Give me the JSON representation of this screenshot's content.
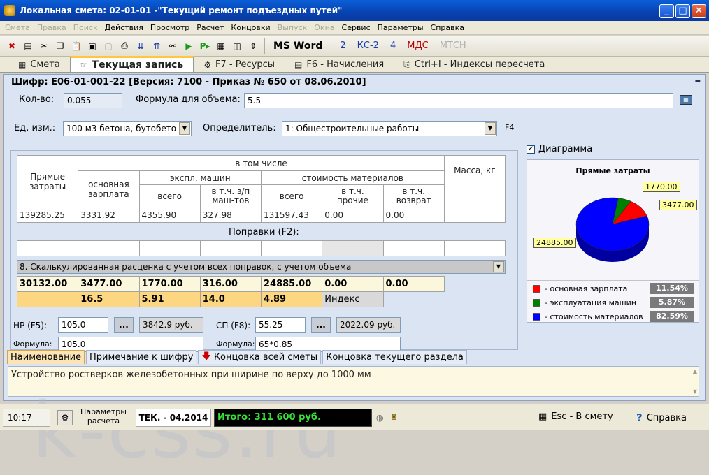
{
  "window": {
    "title": "Локальная смета: 02-01-01 -\"Текущий ремонт подъездных путей\""
  },
  "menu": [
    {
      "label": "Смета",
      "enabled": false
    },
    {
      "label": "Правка",
      "enabled": false
    },
    {
      "label": "Поиск",
      "enabled": false
    },
    {
      "label": "Действия",
      "enabled": true
    },
    {
      "label": "Просмотр",
      "enabled": true
    },
    {
      "label": "Расчет",
      "enabled": true
    },
    {
      "label": "Концовки",
      "enabled": true
    },
    {
      "label": "Выпуск",
      "enabled": false
    },
    {
      "label": "Окна",
      "enabled": false
    },
    {
      "label": "Сервис",
      "enabled": true
    },
    {
      "label": "Параметры",
      "enabled": true
    },
    {
      "label": "Справка",
      "enabled": true
    }
  ],
  "toolbar": {
    "msword": "MS Word",
    "b2": "2",
    "ks2": "КС-2",
    "b4": "4",
    "mds": "МДС",
    "mtsn": "МТСН"
  },
  "tabs": [
    "Смета",
    "Текущая запись",
    "F7 - Ресурсы",
    "F6 - Начисления",
    "Ctrl+I - Индексы пересчета"
  ],
  "record": {
    "shifr": "Шифр: Е06-01-001-22  [Версия: 7100 - Приказ № 650 от 08.06.2010]",
    "qty_label": "Кол-во:",
    "qty": "0.055",
    "formula_label": "Формула для объема:",
    "formula": "5.5",
    "unit_label": "Ед. изм.:",
    "unit": "100 м3 бетона, бутобето",
    "det_label": "Определитель:",
    "det": "1: Общестроительные работы",
    "f4": "F4"
  },
  "table": {
    "h_direct": "Прямые затраты",
    "h_incl": "в том числе",
    "h_wage": "основная зарплата",
    "h_mach": "экспл. машин",
    "h_mat": "стоимость материалов",
    "h_mass": "Масса, кг",
    "h_all": "всего",
    "h_incl_zp": "в т.ч. з/п маш-тов",
    "h_all2": "всего",
    "h_other": "в т.ч. прочие",
    "h_return": "в т.ч. возврат",
    "values": [
      "139285.25",
      "3331.92",
      "4355.90",
      "327.98",
      "131597.43",
      "0.00",
      "0.00",
      ""
    ],
    "corrections_label": "Поправки (F2):",
    "calc_select": "8. Скалькулированная расценка с учетом всех поправок, с учетом объема",
    "calc_values": [
      "30132.00",
      "3477.00",
      "1770.00",
      "316.00",
      "24885.00",
      "0.00",
      "0.00"
    ],
    "index_values": [
      "16.5",
      "5.91",
      "14.0",
      "4.89"
    ],
    "index_label": "Индекс"
  },
  "overhead": {
    "nr_label": "НР (F5):",
    "nr": "105.0",
    "nr_sum": "3842.9 руб.",
    "sp_label": "СП (F8):",
    "sp": "55.25",
    "sp_sum": "2022.09 руб.",
    "formula_label": "Формула:",
    "nr_formula": "105.0",
    "sp_formula": "65*0.85",
    "dots": "..."
  },
  "chart_toggle": "Диаграмма",
  "chart_data": {
    "type": "pie",
    "title": "Прямые затраты",
    "categories": [
      "- основная зарплата",
      "- эксплуатация машин",
      "- стоимость материалов"
    ],
    "values": [
      3477.0,
      1770.0,
      24885.0
    ],
    "value_labels": [
      "3477.00",
      "1770.00",
      "24885.00"
    ],
    "percents": [
      "11.54%",
      "5.87%",
      "82.59%"
    ],
    "colors": [
      "#ff0000",
      "#008000",
      "#0000ff"
    ]
  },
  "bottom_tabs": [
    "Наименование",
    "Примечание к шифру",
    "Концовка всей сметы",
    "Концовка текущего раздела"
  ],
  "description": "Устройство ростверков железобетонных при ширине по верху до 1000 мм",
  "status": {
    "time": "10:17",
    "params": "Параметры расчета",
    "period": "ТЕК. - 04.2014",
    "total": "Итого: 311 600 руб.",
    "esc": "Esc - В смету",
    "help": "Справка"
  }
}
